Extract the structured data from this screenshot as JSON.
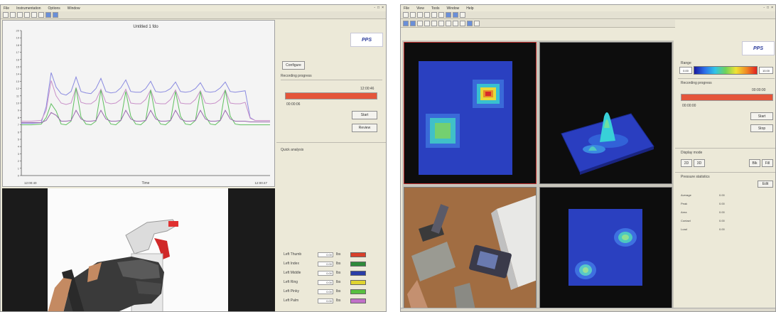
{
  "left_app": {
    "menu": [
      "File",
      "Instrumentation",
      "Options",
      "Window"
    ],
    "window_controls": [
      "-",
      "□",
      "×"
    ],
    "chart_data": {
      "type": "line",
      "title": "Untitled 1 fdo",
      "xlabel": "Time",
      "x_start_label": "12:00:40",
      "x_end_label": "12:00:47",
      "y_tick_labels": [
        "20",
        "19",
        "18",
        "17",
        "16",
        "15",
        "14",
        "13",
        "12",
        "11",
        "10",
        "9",
        "8",
        "7",
        "6",
        "5",
        "4",
        "3",
        "2",
        "1",
        "0"
      ],
      "ylim": [
        0,
        20
      ],
      "x": [
        0,
        4,
        8,
        10,
        12,
        14,
        16,
        18,
        20,
        22,
        24,
        26,
        28,
        30,
        32,
        34,
        36,
        38,
        40,
        42,
        44,
        46,
        48,
        50,
        52,
        54,
        56,
        58,
        60,
        62,
        64,
        66,
        68,
        70,
        72,
        74,
        76,
        78,
        80,
        82,
        84,
        86,
        88,
        90,
        92,
        94,
        96,
        100
      ],
      "series": [
        {
          "color": "#8a8ae0",
          "values": [
            7.2,
            7.2,
            7.3,
            9.5,
            14.2,
            12.2,
            11.3,
            11.1,
            11.6,
            13.6,
            11.6,
            11.4,
            11.3,
            12.0,
            13.4,
            11.6,
            11.4,
            11.5,
            12.1,
            13.2,
            11.6,
            11.5,
            11.5,
            12.0,
            13.0,
            11.6,
            11.5,
            11.6,
            12.0,
            12.9,
            11.6,
            11.5,
            11.6,
            12.0,
            12.8,
            11.6,
            11.5,
            11.6,
            12.1,
            12.9,
            11.6,
            11.5,
            11.6,
            11.7,
            8.0,
            7.6,
            7.6,
            7.6
          ]
        },
        {
          "color": "#c890c8",
          "values": [
            7.5,
            7.5,
            7.6,
            9.0,
            13.1,
            11.0,
            10.0,
            9.8,
            10.0,
            12.1,
            10.1,
            9.9,
            9.9,
            10.4,
            11.9,
            10.1,
            9.9,
            10.0,
            10.5,
            11.9,
            10.0,
            9.9,
            9.9,
            10.5,
            11.8,
            10.0,
            9.9,
            9.9,
            10.5,
            11.8,
            10.0,
            9.9,
            9.9,
            10.5,
            11.7,
            10.0,
            9.9,
            10.0,
            10.5,
            11.8,
            10.0,
            9.9,
            9.9,
            10.1,
            7.9,
            7.6,
            7.6,
            7.6
          ]
        },
        {
          "color": "#60c060",
          "values": [
            7.0,
            7.0,
            7.1,
            8.0,
            9.9,
            8.9,
            7.1,
            7.0,
            7.5,
            12.1,
            8.1,
            7.1,
            7.0,
            7.5,
            11.8,
            8.2,
            7.1,
            7.0,
            7.6,
            11.6,
            8.2,
            7.1,
            7.0,
            7.6,
            11.8,
            8.2,
            7.1,
            7.0,
            7.6,
            11.6,
            8.2,
            7.1,
            7.0,
            7.6,
            11.6,
            8.2,
            7.1,
            7.0,
            7.6,
            11.8,
            8.2,
            7.1,
            7.0,
            7.0,
            7.0,
            7.0,
            7.0,
            7.0
          ]
        },
        {
          "color": "#9a6ab0",
          "values": [
            7.3,
            7.3,
            7.3,
            7.6,
            8.7,
            8.3,
            7.5,
            7.5,
            7.6,
            9.0,
            7.8,
            7.5,
            7.5,
            7.6,
            9.0,
            7.8,
            7.5,
            7.5,
            7.6,
            9.0,
            7.8,
            7.5,
            7.5,
            7.6,
            9.0,
            7.8,
            7.5,
            7.5,
            7.6,
            9.0,
            7.8,
            7.5,
            7.5,
            7.6,
            9.0,
            7.8,
            7.5,
            7.5,
            7.6,
            9.0,
            7.8,
            7.5,
            7.5,
            7.5,
            7.4,
            7.4,
            7.4,
            7.4
          ]
        }
      ]
    },
    "side": {
      "logo": "PPS",
      "top_button": "Configure",
      "section_title": "Recording progress",
      "progress_percent": 100,
      "progress_value": "12:00:46",
      "progress_sub": "00:00:06",
      "btn_start": "Start",
      "btn_stop": "Review",
      "analysis_title": "Quick analysis",
      "channels": [
        {
          "name": "Left Thumb",
          "value": "0.00",
          "unit": "lbs",
          "color": "#d8402a"
        },
        {
          "name": "Left Index",
          "value": "0.00",
          "unit": "lbs",
          "color": "#2e8a3a"
        },
        {
          "name": "Left Middle",
          "value": "0.00",
          "unit": "lbs",
          "color": "#2a3ea8"
        },
        {
          "name": "Left Ring",
          "value": "0.00",
          "unit": "lbs",
          "color": "#e0d430"
        },
        {
          "name": "Left Pinky",
          "value": "0.00",
          "unit": "lbs",
          "color": "#58c040"
        },
        {
          "name": "Left Palm",
          "value": "0.00",
          "unit": "lbs",
          "color": "#c070c8"
        }
      ]
    }
  },
  "right_app": {
    "menu": [
      "File",
      "View",
      "Tools",
      "Window",
      "Help"
    ],
    "window_controls": [
      "-",
      "□",
      "×"
    ],
    "side": {
      "logo": "PPS",
      "colorbar_label": "Range",
      "range_min": "0.00",
      "range_max": "10.00",
      "section_title": "Recording progress",
      "progress_percent": 100,
      "progress_value": "00:00:00",
      "progress_sub": "00:00:00",
      "btn_start": "Start",
      "btn_stop": "Stop",
      "mode_title": "Display mode",
      "btn_2d": "2D",
      "btn_3d": "3D",
      "btn_a": "Blk",
      "btn_b": "Fill",
      "stats_title": "Pressure statistics",
      "btn_edit": "Edit",
      "stats": [
        {
          "label": "Average",
          "value": "0.00"
        },
        {
          "label": "Peak",
          "value": "0.00"
        },
        {
          "label": "Area",
          "value": "0.00"
        },
        {
          "label": "Contact",
          "value": "0.00"
        },
        {
          "label": "Load",
          "value": "0.00"
        }
      ]
    }
  }
}
